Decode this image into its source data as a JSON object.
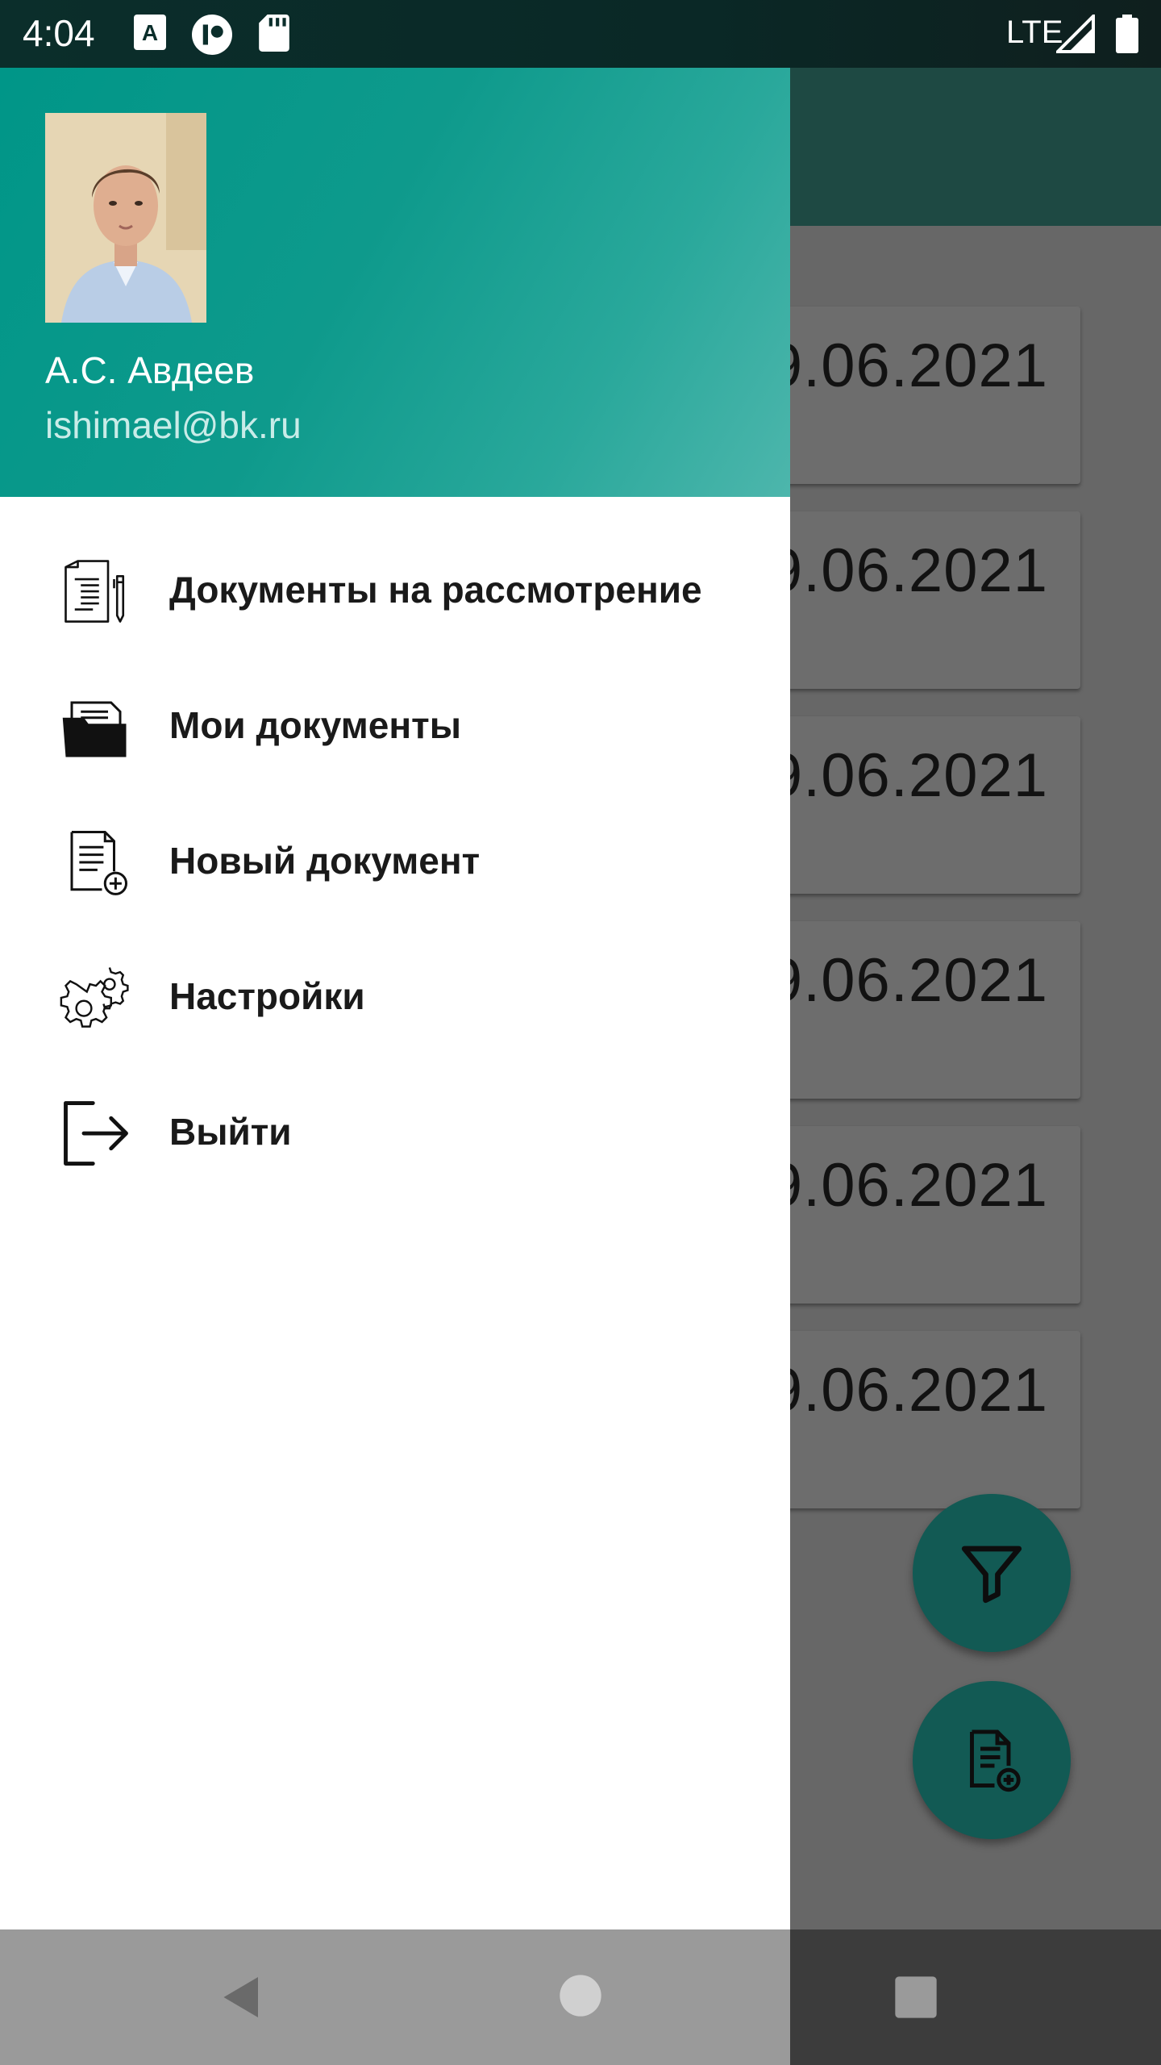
{
  "status_bar": {
    "time": "4:04",
    "network": "LTE"
  },
  "background": {
    "card_dates": [
      "9.06.2021",
      "9.06.2021",
      "9.06.2021",
      "9.06.2021",
      "9.06.2021",
      "9.06.2021"
    ],
    "fab_filter_icon": "filter-icon",
    "fab_new_icon": "new-document-icon"
  },
  "drawer": {
    "user_name": "А.С. Авдеев",
    "user_email": "ishimael@bk.ru",
    "menu": [
      {
        "label": "Документы на рассмотрение",
        "icon": "documents-review-icon"
      },
      {
        "label": "Мои документы",
        "icon": "folder-icon"
      },
      {
        "label": "Новый документ",
        "icon": "new-document-icon"
      },
      {
        "label": "Настройки",
        "icon": "settings-icon"
      },
      {
        "label": "Выйти",
        "icon": "logout-icon"
      }
    ]
  },
  "colors": {
    "header": "#009688",
    "fab": "#125a54",
    "scrim_app_bar": "#1e4943"
  }
}
